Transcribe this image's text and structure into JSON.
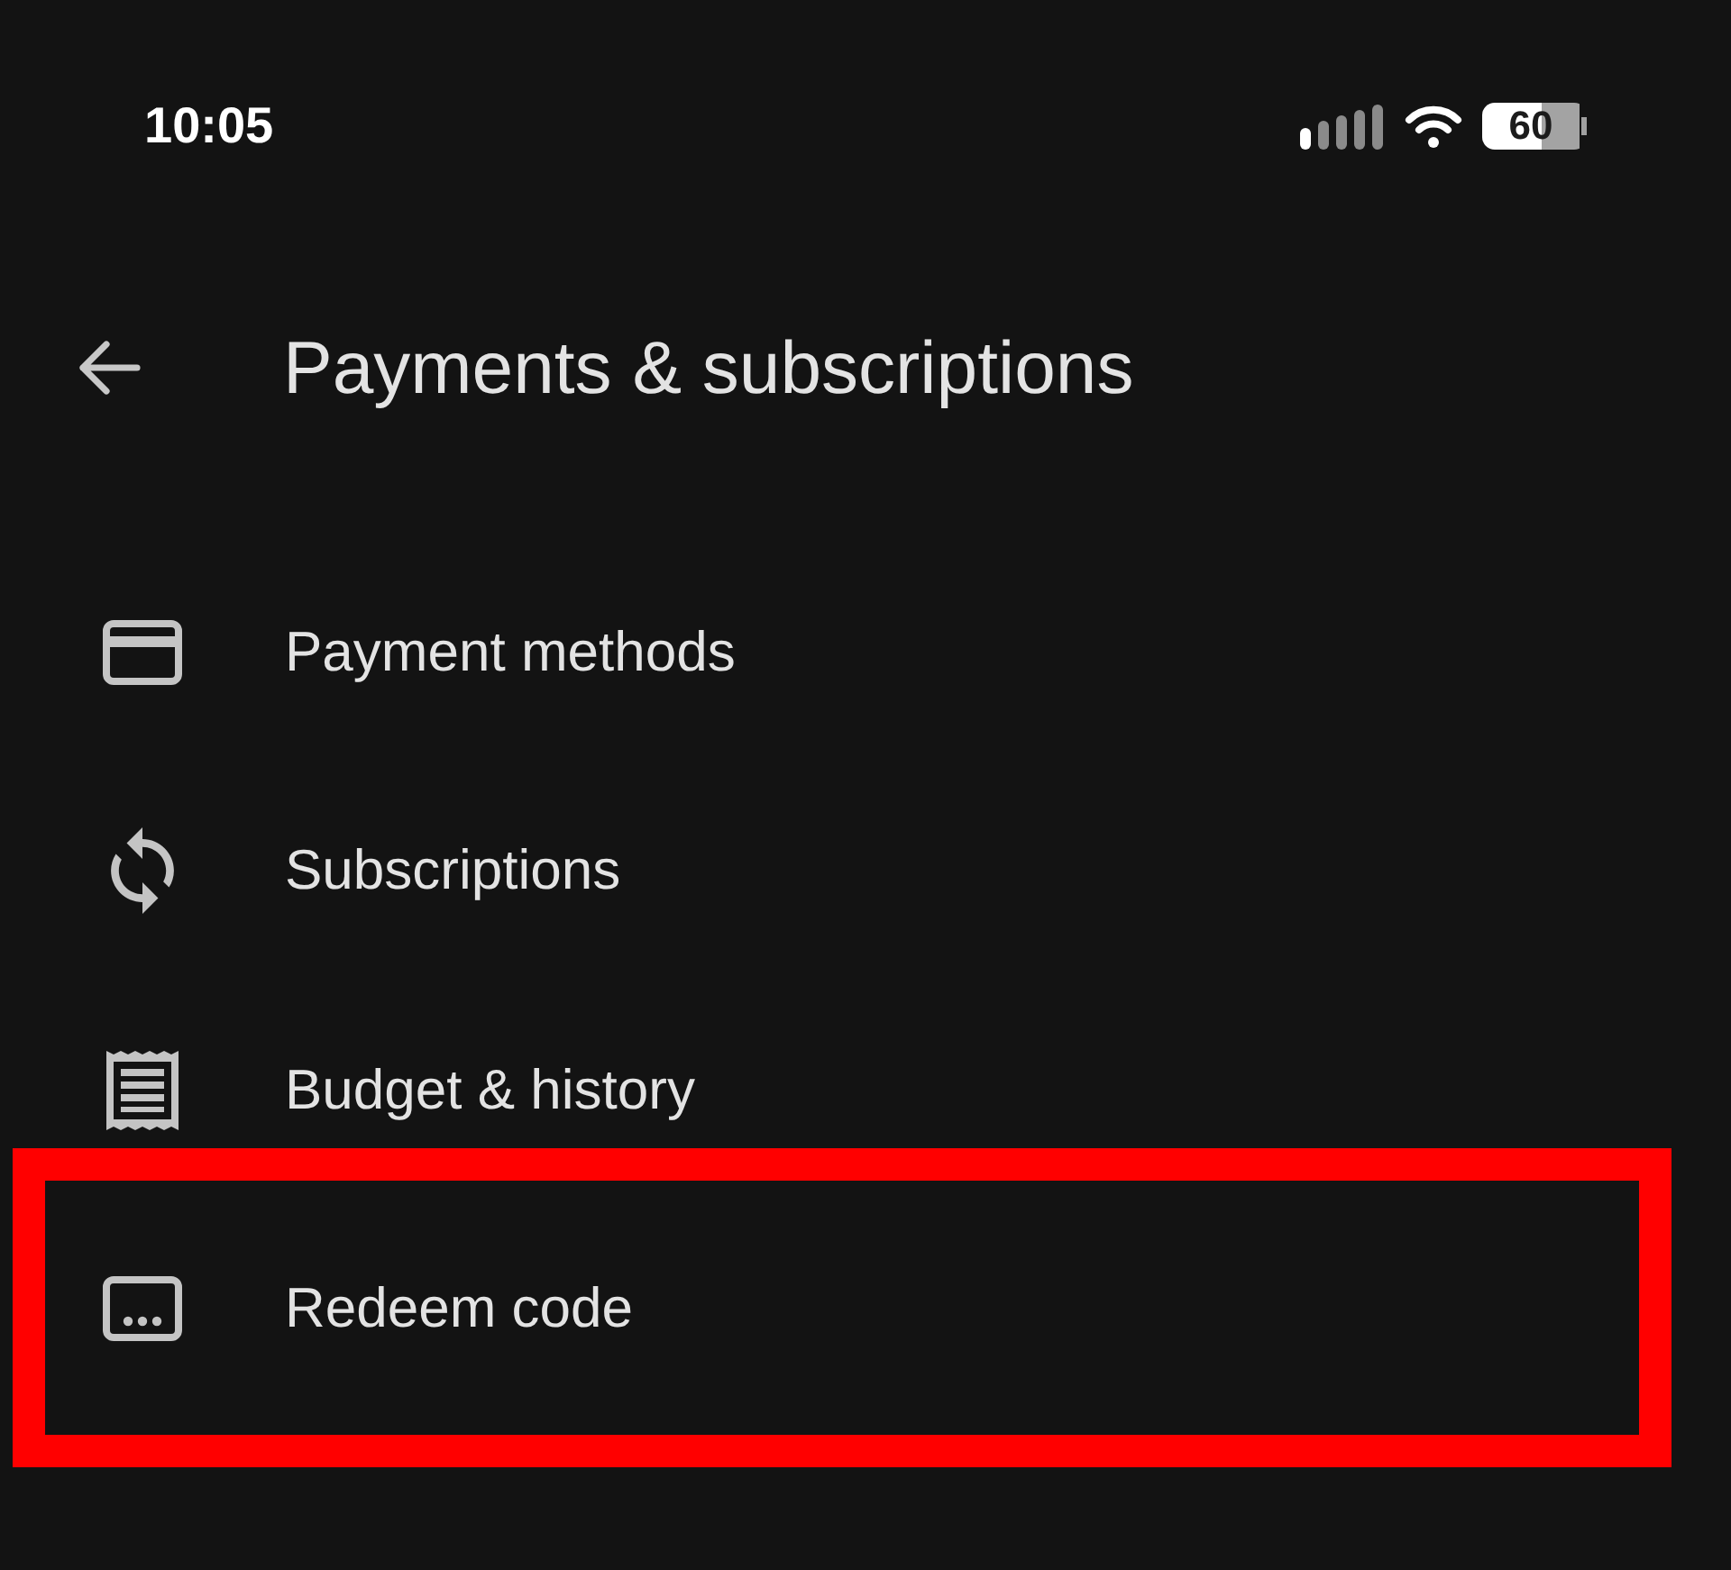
{
  "status_bar": {
    "time": "10:05",
    "battery": "60"
  },
  "header": {
    "title": "Payments & subscriptions"
  },
  "items": [
    {
      "label": "Payment methods",
      "highlighted": false
    },
    {
      "label": "Subscriptions",
      "highlighted": false
    },
    {
      "label": "Budget & history",
      "highlighted": false
    },
    {
      "label": "Redeem code",
      "highlighted": true
    }
  ]
}
